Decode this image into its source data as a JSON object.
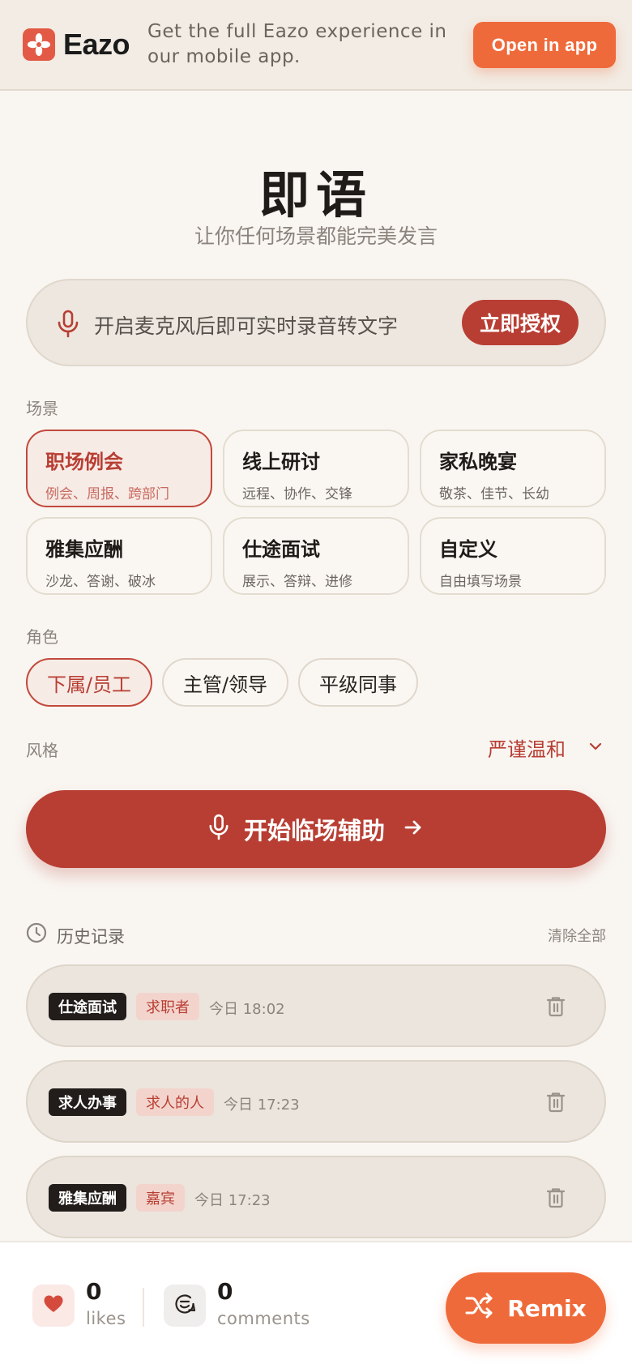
{
  "banner": {
    "logo_text": "Eazo",
    "message": "Get the full Eazo experience in our mobile app.",
    "open_button": "Open in app"
  },
  "header": {
    "title": "即语",
    "subtitle": "让你任何场景都能完美发言"
  },
  "mic_bar": {
    "prompt": "开启麦克风后即可实时录音转文字",
    "authorize_button": "立即授权"
  },
  "scene": {
    "label": "场景",
    "selected": 0,
    "options": [
      {
        "title": "职场例会",
        "subtitle": "例会、周报、跨部门"
      },
      {
        "title": "线上研讨",
        "subtitle": "远程、协作、交锋"
      },
      {
        "title": "家私晚宴",
        "subtitle": "敬茶、佳节、长幼"
      },
      {
        "title": "雅集应酬",
        "subtitle": "沙龙、答谢、破冰"
      },
      {
        "title": "仕途面试",
        "subtitle": "展示、答辩、进修"
      },
      {
        "title": "自定义",
        "subtitle": "自由填写场景"
      }
    ]
  },
  "role": {
    "label": "角色",
    "selected": 0,
    "options": [
      "下属/员工",
      "主管/领导",
      "平级同事"
    ]
  },
  "style": {
    "label": "风格",
    "value": "严谨温和"
  },
  "start_button": {
    "label": "开始临场辅助"
  },
  "history": {
    "title": "历史记录",
    "clear_all": "清除全部",
    "items": [
      {
        "scene": "仕途面试",
        "role": "求职者",
        "time": "今日 18:02"
      },
      {
        "scene": "求人办事",
        "role": "求人的人",
        "time": "今日 17:23"
      },
      {
        "scene": "雅集应酬",
        "role": "嘉宾",
        "time": "今日 17:23"
      }
    ]
  },
  "bottom_bar": {
    "likes_count": "0",
    "likes_label": "likes",
    "comments_count": "0",
    "comments_label": "comments",
    "remix_label": "Remix"
  },
  "colors": {
    "accent": "#b83e33",
    "brand_orange": "#ef6a3a",
    "background": "#f9f6f2"
  },
  "icons": [
    "eazo-logo-icon",
    "microphone-icon",
    "chevron-down-icon",
    "arrow-right-icon",
    "clock-icon",
    "trash-icon",
    "heart-icon",
    "comment-icon",
    "shuffle-icon"
  ]
}
